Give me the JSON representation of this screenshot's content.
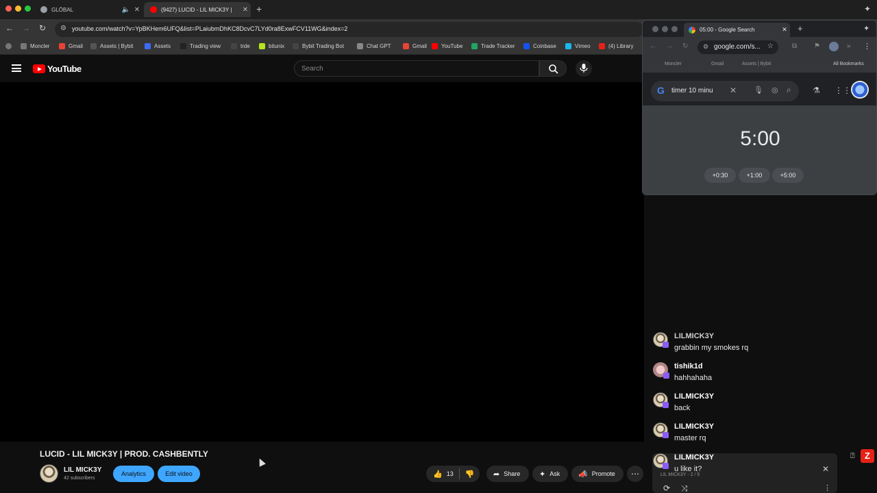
{
  "browser": {
    "tabs": [
      {
        "title": "GLÖBAL",
        "favicon_color": "#9aa0a6"
      },
      {
        "title": "(9427) LUCID - LIL MICK3Y |",
        "favicon_color": "#ff0000"
      }
    ],
    "url": "youtube.com/watch?v=YpBKHem6UFQ&list=PLaiubmDhKC8DcvC7LYd0ra8ExwFCV11WG&index=2",
    "bookmarks": [
      {
        "label": "Moncler",
        "color": "#777"
      },
      {
        "label": "Gmail",
        "color": "#ea4335"
      },
      {
        "label": "Assets | Bybit",
        "color": "#555"
      },
      {
        "label": "Assets",
        "color": "#3b6cf5"
      },
      {
        "label": "Trading view",
        "color": "#222"
      },
      {
        "label": "trde",
        "color": "#444"
      },
      {
        "label": "bitunix",
        "color": "#b5e61d"
      },
      {
        "label": "Bybit Trading Bot",
        "color": "#444"
      },
      {
        "label": "Chat GPT",
        "color": "#888"
      },
      {
        "label": "Gmail",
        "color": "#ea4335"
      },
      {
        "label": "YouTube",
        "color": "#ff0000"
      },
      {
        "label": "Trade Tracker",
        "color": "#1fa463"
      },
      {
        "label": "Coinbase",
        "color": "#1652f0"
      },
      {
        "label": "Vimeo",
        "color": "#1ab7ea"
      },
      {
        "label": "(4) Library",
        "color": "#e62117"
      }
    ]
  },
  "youtube": {
    "logo": "YouTube",
    "search_placeholder": "Search",
    "video_title": "LUCID - LIL MICK3Y | PROD. CASHBENTLY",
    "channel_name": "LIL MICK3Y",
    "subscribers": "42 subscribers",
    "analytics_label": "Analytics",
    "edit_label": "Edit video",
    "likes": "13",
    "share_label": "Share",
    "ask_label": "Ask",
    "promote_label": "Promote"
  },
  "google_window": {
    "tab_title": "05:00 - Google Search",
    "url": "google.com/s...",
    "bookmarks": [
      "Moncler",
      "Gmail",
      "Assets | Bybit"
    ],
    "all_bookmarks": "All Bookmarks",
    "query": "timer 10 minu",
    "timer": "5:00",
    "buttons": [
      "+0:30",
      "+1:00",
      "+5:00"
    ]
  },
  "chat": {
    "messages": [
      {
        "user": "LILMICK3Y",
        "text": "grabbin my smokes rq",
        "user_color": "#d8d8d8"
      },
      {
        "user": "tishik1d",
        "text": "hahhahaha",
        "user_color": "#ffffff"
      },
      {
        "user": "LILMICK3Y",
        "text": "back",
        "user_color": "#ffffff"
      },
      {
        "user": "LILMICK3Y",
        "text": "master rq",
        "user_color": "#ffffff"
      },
      {
        "user": "LILMICK3Y",
        "text": "u like it?",
        "user_color": "#ffffff"
      }
    ],
    "mini_label": "LIL MICK3Y - 2 / 5",
    "red_badge": "Z"
  }
}
